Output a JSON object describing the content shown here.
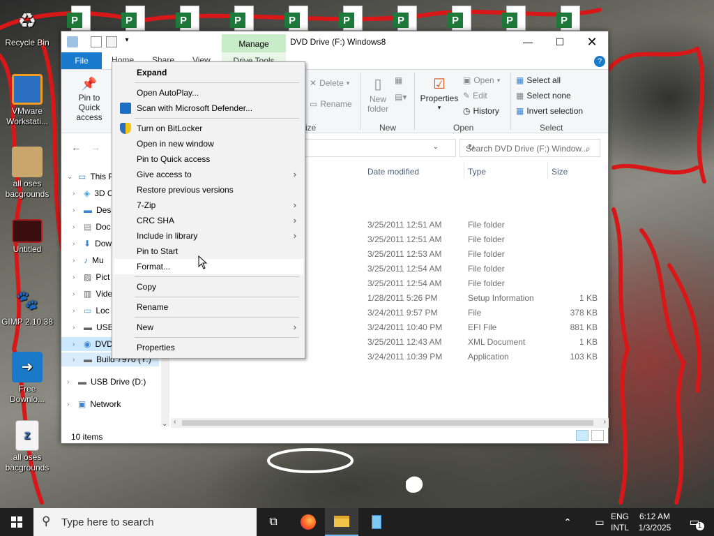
{
  "desktop": {
    "icons": [
      {
        "label": "Recycle Bin",
        "icon": "recycle-bin-icon"
      },
      {
        "label": "VMware Workstati...",
        "icon": "vmware-icon"
      },
      {
        "label": "all oses bacgrounds",
        "icon": "folder-icon"
      },
      {
        "label": "Untitled",
        "icon": "image-file-icon"
      },
      {
        "label": "GIMP 2.10.38",
        "icon": "gimp-icon"
      },
      {
        "label": "Free Downlo...",
        "icon": "free-download-manager-icon"
      },
      {
        "label": "all oses bacgrounds",
        "icon": "zip-file-icon"
      }
    ],
    "top_icon_letter": "P"
  },
  "window": {
    "title": "DVD Drive (F:) Windows8",
    "manage_tab": "Manage",
    "tabs": {
      "file": "File",
      "home": "Home",
      "share": "Share",
      "view": "View",
      "drive_tools": "Drive Tools"
    },
    "ribbon": {
      "pin_quick_access": "Pin to Quick access",
      "delete": "Delete",
      "rename": "Rename",
      "new_folder": "New folder",
      "properties": "Properties",
      "open": "Open",
      "edit": "Edit",
      "history": "History",
      "select_all": "Select all",
      "select_none": "Select none",
      "invert_selection": "Invert selection",
      "groups": {
        "organize": "ize",
        "new": "New",
        "open": "Open",
        "select": "Select"
      }
    },
    "search_placeholder": "Search DVD Drive (F:) Window...",
    "nav": [
      {
        "label": "This P",
        "icon": "this-pc-icon"
      },
      {
        "label": "3D O",
        "icon": "3d-objects-icon"
      },
      {
        "label": "Des",
        "icon": "desktop-folder-icon"
      },
      {
        "label": "Doc",
        "icon": "documents-icon"
      },
      {
        "label": "Dow",
        "icon": "downloads-icon"
      },
      {
        "label": "Mu",
        "icon": "music-icon"
      },
      {
        "label": "Pict",
        "icon": "pictures-icon"
      },
      {
        "label": "Vide",
        "icon": "videos-icon"
      },
      {
        "label": "Loc",
        "icon": "local-disk-icon"
      },
      {
        "label": "USB",
        "icon": "usb-drive-icon"
      },
      {
        "label": "DVD",
        "icon": "dvd-drive-icon"
      },
      {
        "label": "Build 7970 (Y:)",
        "icon": "drive-icon"
      },
      {
        "label": "USB Drive (D:)",
        "icon": "usb-drive-icon"
      },
      {
        "label": "Network",
        "icon": "network-icon"
      }
    ],
    "columns": {
      "date": "Date modified",
      "type": "Type",
      "size": "Size"
    },
    "rows": [
      {
        "date": "3/25/2011 12:51 AM",
        "type": "File folder",
        "size": ""
      },
      {
        "date": "3/25/2011 12:51 AM",
        "type": "File folder",
        "size": ""
      },
      {
        "date": "3/25/2011 12:53 AM",
        "type": "File folder",
        "size": ""
      },
      {
        "date": "3/25/2011 12:54 AM",
        "type": "File folder",
        "size": ""
      },
      {
        "date": "3/25/2011 12:54 AM",
        "type": "File folder",
        "size": ""
      },
      {
        "date": "1/28/2011 5:26 PM",
        "type": "Setup Information",
        "size": "1 KB"
      },
      {
        "date": "3/24/2011 9:57 PM",
        "type": "File",
        "size": "378 KB"
      },
      {
        "date": "3/24/2011 10:40 PM",
        "type": "EFI File",
        "size": "881 KB"
      },
      {
        "date": "3/25/2011 12:43 AM",
        "type": "XML Document",
        "size": "1 KB"
      },
      {
        "date": "3/24/2011 10:39 PM",
        "type": "Application",
        "size": "103 KB"
      }
    ],
    "status": "10 items"
  },
  "context_menu": {
    "items": [
      {
        "label": "Expand",
        "bold": true
      },
      {
        "label": "Open AutoPlay..."
      },
      {
        "label": "Scan with Microsoft Defender...",
        "icon": "defender-icon"
      },
      {
        "label": "Turn on BitLocker",
        "icon": "shield-icon"
      },
      {
        "label": "Open in new window"
      },
      {
        "label": "Pin to Quick access"
      },
      {
        "label": "Give access to",
        "submenu": true
      },
      {
        "label": "Restore previous versions"
      },
      {
        "label": "7-Zip",
        "submenu": true
      },
      {
        "label": "CRC SHA",
        "submenu": true
      },
      {
        "label": "Include in library",
        "submenu": true
      },
      {
        "label": "Pin to Start"
      },
      {
        "label": "Format..."
      },
      {
        "label": "Copy"
      },
      {
        "label": "Rename"
      },
      {
        "label": "New",
        "submenu": true
      },
      {
        "label": "Properties"
      }
    ]
  },
  "taskbar": {
    "search_placeholder": "Type here to search",
    "lang1": "ENG",
    "lang2": "INTL",
    "time": "6:12 AM",
    "date": "1/3/2025",
    "notification_count": "1"
  }
}
